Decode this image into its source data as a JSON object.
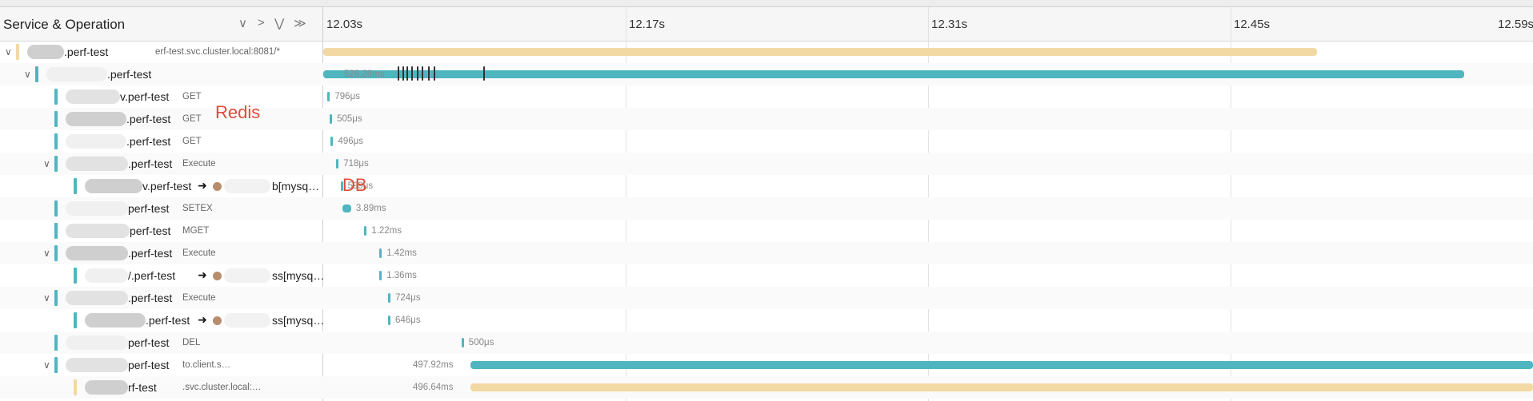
{
  "left_header": {
    "title": "Service & Operation",
    "controls": [
      "∨",
      ">",
      "⋁",
      "≫"
    ]
  },
  "timeline": {
    "ticks": [
      "12.03s",
      "12.17s",
      "12.31s",
      "12.45s",
      "12.59s"
    ]
  },
  "colors": {
    "teal": "#4fb6bf",
    "tan": "#f2d9a4",
    "annotation": "#e14b3b"
  },
  "rows": [
    {
      "name": ".perf-test",
      "op": "erf-test.svc.cluster.local:8081/*",
      "duration": "",
      "color": "tan",
      "bar_start": 0,
      "bar_end": 0.46
    },
    {
      "name": ".perf-test",
      "op": "",
      "duration": "528.28ms",
      "color": "teal",
      "bar_start": 0,
      "bar_end": 0.528
    },
    {
      "name": "v.perf-test",
      "op": "GET",
      "duration": "796μs",
      "color": "teal",
      "bar_start": 0.002,
      "bar_end": 0.0028
    },
    {
      "name": ".perf-test",
      "op": "GET",
      "duration": "505μs",
      "color": "teal",
      "bar_start": 0.003,
      "bar_end": 0.0035
    },
    {
      "name": ".perf-test",
      "op": "GET",
      "duration": "496μs",
      "color": "teal",
      "bar_start": 0.0035,
      "bar_end": 0.004
    },
    {
      "name": ".perf-test",
      "op": "Execute",
      "duration": "718μs",
      "color": "teal",
      "bar_start": 0.006,
      "bar_end": 0.0067
    },
    {
      "name": "v.perf-test",
      "op": "",
      "duration": "599μs",
      "target": "b[mysq…",
      "color": "teal",
      "bar_start": 0.008,
      "bar_end": 0.0086
    },
    {
      "name": "perf-test",
      "op": "SETEX",
      "duration": "3.89ms",
      "color": "teal",
      "bar_start": 0.009,
      "bar_end": 0.0129
    },
    {
      "name": "perf-test",
      "op": "MGET",
      "duration": "1.22ms",
      "color": "teal",
      "bar_start": 0.019,
      "bar_end": 0.0202
    },
    {
      "name": ".perf-test",
      "op": "Execute",
      "duration": "1.42ms",
      "color": "teal",
      "bar_start": 0.026,
      "bar_end": 0.0274
    },
    {
      "name": "/.perf-test",
      "op": "",
      "duration": "1.36ms",
      "target": "ss[mysq…",
      "color": "teal",
      "bar_start": 0.026,
      "bar_end": 0.0274
    },
    {
      "name": ".perf-test",
      "op": "Execute",
      "duration": "724μs",
      "color": "teal",
      "bar_start": 0.03,
      "bar_end": 0.0307
    },
    {
      "name": ".perf-test",
      "op": "",
      "duration": "646μs",
      "target": "ss[mysq…",
      "color": "teal",
      "bar_start": 0.03,
      "bar_end": 0.0306
    },
    {
      "name": "perf-test",
      "op": "DEL",
      "duration": "500μs",
      "color": "teal",
      "bar_start": 0.064,
      "bar_end": 0.0645
    },
    {
      "name": "perf-test",
      "op": "to.client.s…",
      "duration": "497.92ms",
      "color": "teal",
      "bar_start": 0.068,
      "bar_end": 0.566
    },
    {
      "name": "rf-test",
      "op": ".svc.cluster.local:…",
      "duration": "496.64ms",
      "color": "tan",
      "bar_start": 0.068,
      "bar_end": 0.565
    }
  ],
  "annotations": {
    "redis": "Redis",
    "db": "DB"
  }
}
